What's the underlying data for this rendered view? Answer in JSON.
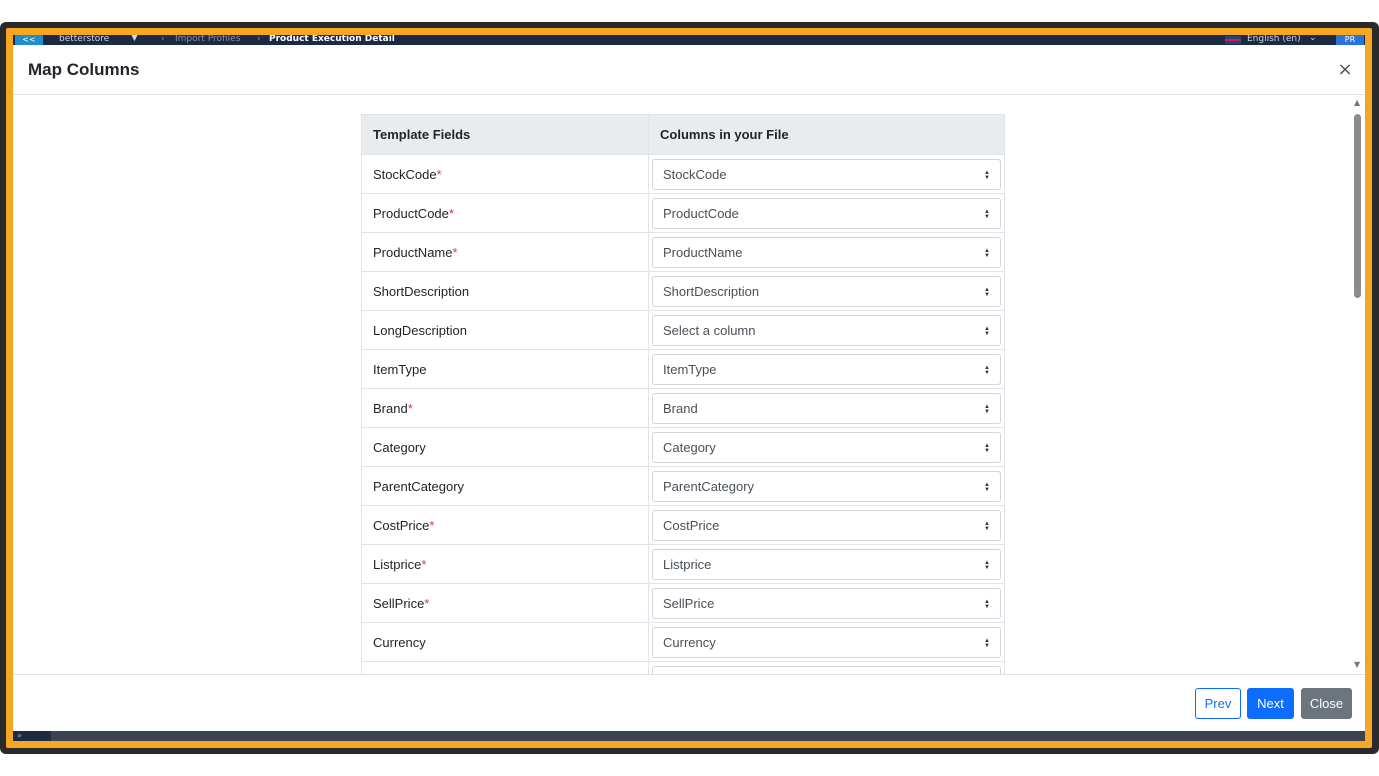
{
  "app_bar": {
    "back_icon": "double-chevron-left-icon",
    "store_name": "betterstore",
    "breadcrumbs": [
      "Import Profiles",
      "Product Execution Detail"
    ],
    "language": "English (en)",
    "avatar_initials": "PR"
  },
  "modal": {
    "title": "Map Columns",
    "close_symbol": "×",
    "table": {
      "headers": [
        "Template Fields",
        "Columns in your File"
      ],
      "rows": [
        {
          "field": "StockCode",
          "required": "*",
          "selected": "StockCode"
        },
        {
          "field": "ProductCode",
          "required": "*",
          "selected": "ProductCode"
        },
        {
          "field": "ProductName",
          "required": "*",
          "selected": "ProductName"
        },
        {
          "field": "ShortDescription",
          "required": "",
          "selected": "ShortDescription"
        },
        {
          "field": "LongDescription",
          "required": "",
          "selected": "Select a column"
        },
        {
          "field": "ItemType",
          "required": "",
          "selected": "ItemType"
        },
        {
          "field": "Brand",
          "required": "*",
          "selected": "Brand"
        },
        {
          "field": "Category",
          "required": "",
          "selected": "Category"
        },
        {
          "field": "ParentCategory",
          "required": "",
          "selected": "ParentCategory"
        },
        {
          "field": "CostPrice",
          "required": "*",
          "selected": "CostPrice"
        },
        {
          "field": "Listprice",
          "required": "*",
          "selected": "Listprice"
        },
        {
          "field": "SellPrice",
          "required": "*",
          "selected": "SellPrice"
        },
        {
          "field": "Currency",
          "required": "",
          "selected": "Currency"
        },
        {
          "field": "",
          "required": "",
          "selected": ""
        }
      ]
    },
    "footer": {
      "prev_label": "Prev",
      "next_label": "Next",
      "close_label": "Close"
    }
  },
  "colors": {
    "accent_frame": "#f5a623",
    "primary": "#0d6efd",
    "secondary": "#6c757d",
    "required": "#dc3545"
  }
}
